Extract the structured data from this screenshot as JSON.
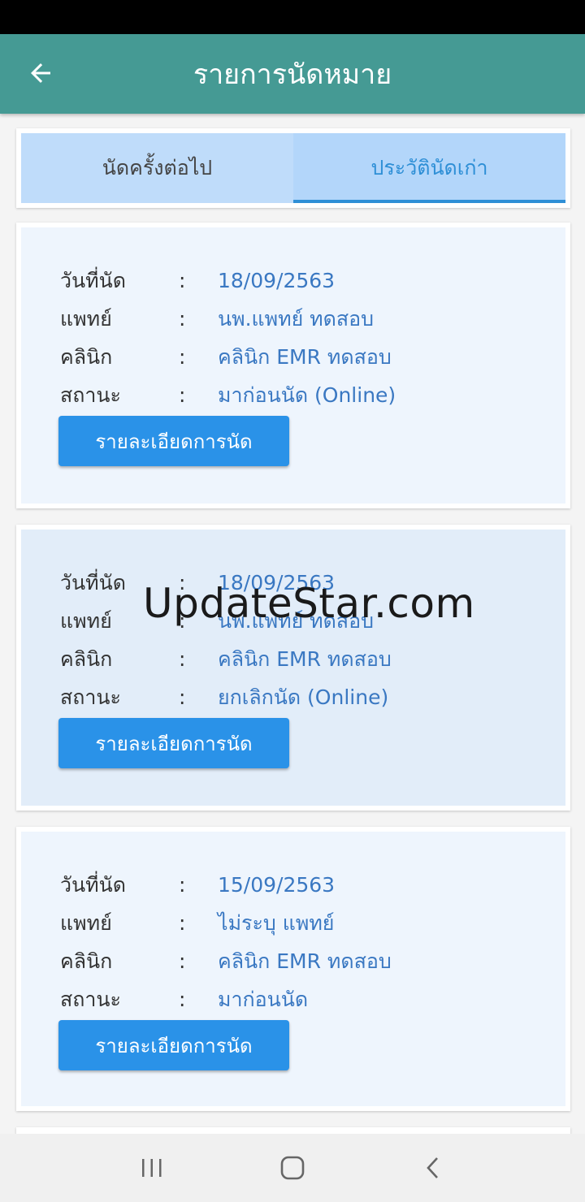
{
  "header": {
    "title": "รายการนัดหมาย",
    "back_icon": "arrow-left-icon"
  },
  "tabs": [
    {
      "label": "นัดครั้งต่อไป",
      "active": false
    },
    {
      "label": "ประวัตินัดเก่า",
      "active": true
    }
  ],
  "labels": {
    "date": "วันที่นัด",
    "doctor": "แพทย์",
    "clinic": "คลินิก",
    "status": "สถานะ",
    "colon": ":"
  },
  "appointments": [
    {
      "date": "18/09/2563",
      "doctor": "นพ.แพทย์ ทดสอบ",
      "clinic": "คลินิก EMR ทดสอบ",
      "status": "มาก่อนนัด (Online)",
      "button": "รายละเอียดการนัด"
    },
    {
      "date": "18/09/2563",
      "doctor": "นพ.แพทย์ ทดสอบ",
      "clinic": "คลินิก EMR ทดสอบ",
      "status": "ยกเลิกนัด (Online)",
      "button": "รายละเอียดการนัด"
    },
    {
      "date": "15/09/2563",
      "doctor": "ไม่ระบุ แพทย์",
      "clinic": "คลินิก EMR ทดสอบ",
      "status": "มาก่อนนัด",
      "button": "รายละเอียดการนัด"
    }
  ],
  "watermark": "UpdateStar.com",
  "nav": {
    "recents_icon": "recents-icon",
    "home_icon": "home-icon",
    "back_icon": "chevron-left-icon"
  },
  "colors": {
    "app_bar": "#459a94",
    "accent": "#2e8fd6",
    "button": "#2a92e8",
    "value_text": "#3a78c2"
  }
}
